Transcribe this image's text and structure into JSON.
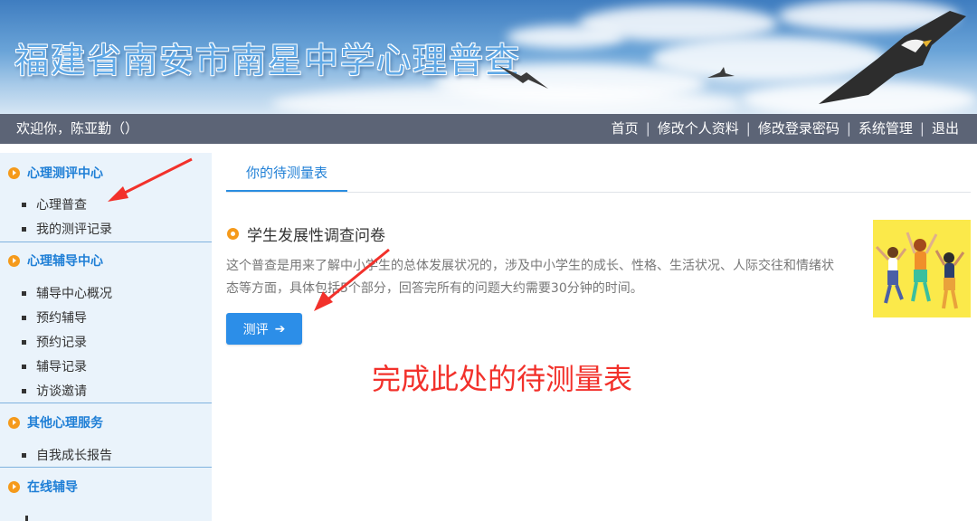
{
  "banner": {
    "title": "福建省南安市南星中学心理普查"
  },
  "topbar": {
    "welcome": "欢迎你，陈亚勤（）",
    "nav": [
      "首页",
      "修改个人资料",
      "修改登录密码",
      "系统管理",
      "退出"
    ],
    "separator": "|"
  },
  "sidebar": {
    "sections": [
      {
        "title": "心理测评中心",
        "items": [
          "心理普查",
          "我的测评记录"
        ]
      },
      {
        "title": "心理辅导中心",
        "items": [
          "辅导中心概况",
          "预约辅导",
          "预约记录",
          "辅导记录",
          "访谈邀请"
        ]
      },
      {
        "title": "其他心理服务",
        "items": [
          "自我成长报告"
        ]
      },
      {
        "title": "在线辅导",
        "items": []
      }
    ]
  },
  "main": {
    "tab": "你的待测量表",
    "survey": {
      "title": "学生发展性调查问卷",
      "description": "这个普查是用来了解中小学生的总体发展状况的，涉及中小学生的成长、性格、生活状况、人际交往和情绪状态等方面，具体包括5个部分，回答完所有的问题大约需要30分钟的时间。",
      "button": "测评",
      "button_icon": "arrow-right-icon"
    },
    "annotation": "完成此处的待测量表"
  },
  "colors": {
    "topbar": "#5c6476",
    "accent": "#2c8ee8",
    "orange": "#f59a1b",
    "annotation_red": "#f2312b",
    "sidebar_bg": "#eaf3fb"
  }
}
